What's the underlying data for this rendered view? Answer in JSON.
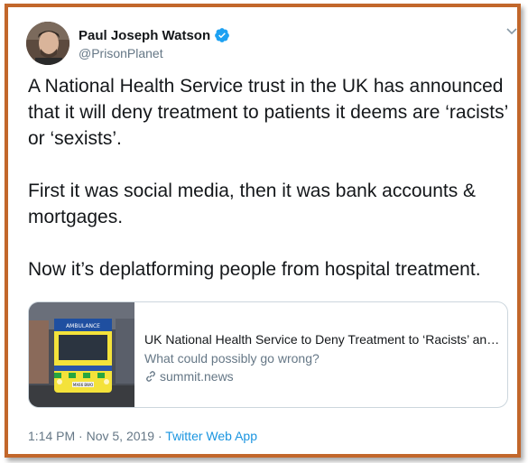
{
  "author": {
    "display_name": "Paul Joseph Watson",
    "handle": "@PrisonPlanet",
    "verified_icon": "verified-badge-icon",
    "verified_color": "#1da1f2"
  },
  "tweet": {
    "text": "A National Health Service trust in the UK has announced that it will deny treatment to patients it deems are ‘racists’ or ‘sexists’.\n\nFirst it was social media, then it was bank accounts & mortgages.\n\nNow it’s deplatforming people from hospital treatment."
  },
  "link_card": {
    "title": "UK National Health Service to Deny Treatment to ‘Racists’ and...",
    "description": "What could possibly go wrong?",
    "domain": "summit.news",
    "domain_icon": "link-icon",
    "thumbnail_text": "AMBULANCE",
    "plate_text": "MX66 BWO"
  },
  "meta": {
    "time": "1:14 PM",
    "separator": "·",
    "date": "Nov 5, 2019",
    "source": "Twitter Web App"
  },
  "colors": {
    "frame_border": "#c2672b",
    "link_blue": "#1b95e0",
    "secondary_text": "#657786"
  }
}
